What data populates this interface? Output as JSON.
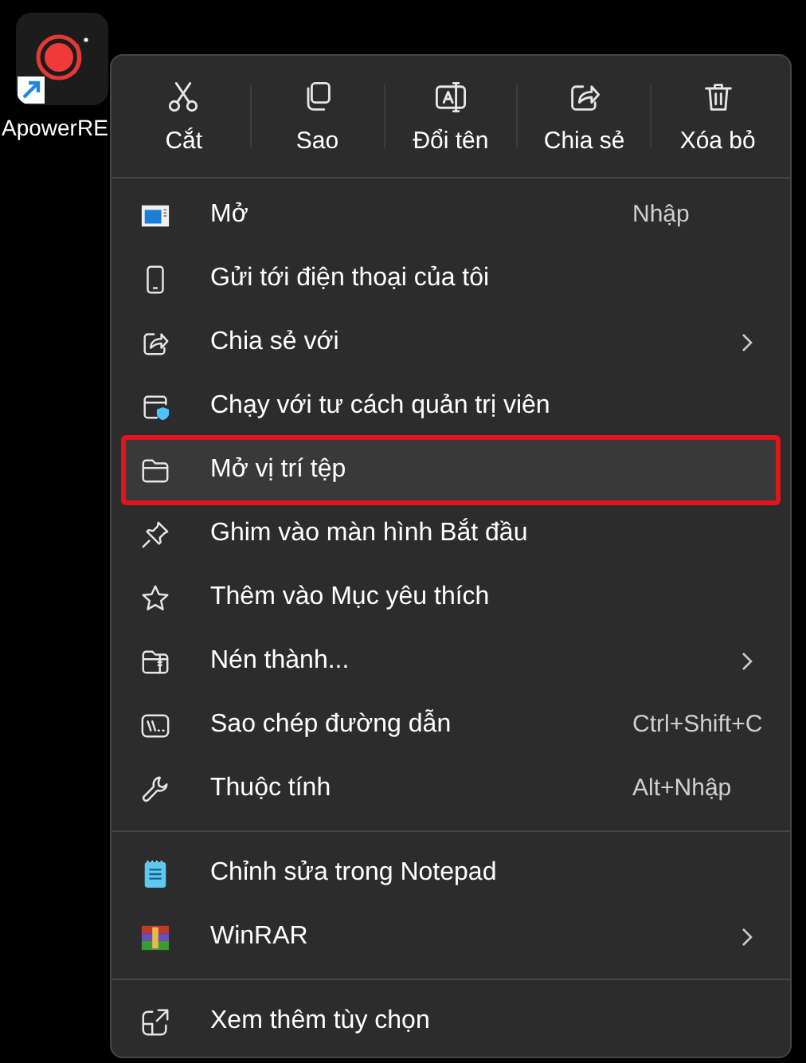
{
  "desktop_icon": {
    "label": "ApowerRE"
  },
  "toolbar": [
    {
      "kind": "cut",
      "label": "Cắt"
    },
    {
      "kind": "copy",
      "label": "Sao"
    },
    {
      "kind": "rename",
      "label": "Đổi tên"
    },
    {
      "kind": "share",
      "label": "Chia sẻ"
    },
    {
      "kind": "delete",
      "label": "Xóa bỏ"
    }
  ],
  "sections": [
    {
      "items": [
        {
          "kind": "open",
          "label": "Mở",
          "shortcut": "Nhập",
          "submenu": false,
          "selected": false
        },
        {
          "kind": "phone",
          "label": "Gửi tới điện thoại của tôi",
          "submenu": false,
          "selected": false
        },
        {
          "kind": "share",
          "label": "Chia sẻ với",
          "submenu": true,
          "selected": false
        },
        {
          "kind": "admin",
          "label": "Chạy với tư cách quản trị viên",
          "submenu": false,
          "selected": false
        },
        {
          "kind": "folder",
          "label": "Mở vị trí tệp",
          "submenu": false,
          "selected": true
        },
        {
          "kind": "pin",
          "label": "Ghim vào màn hình Bắt đầu",
          "submenu": false,
          "selected": false
        },
        {
          "kind": "star",
          "label": "Thêm vào Mục yêu thích",
          "submenu": false,
          "selected": false
        },
        {
          "kind": "zip",
          "label": "Nén thành...",
          "submenu": true,
          "selected": false
        },
        {
          "kind": "path",
          "label": "Sao chép đường dẫn",
          "shortcut": "Ctrl+Shift+C",
          "submenu": false,
          "selected": false
        },
        {
          "kind": "wrench",
          "label": "Thuộc tính",
          "shortcut": "Alt+Nhập",
          "submenu": false,
          "selected": false
        }
      ]
    },
    {
      "items": [
        {
          "kind": "notepad",
          "label": "Chỉnh sửa trong Notepad",
          "submenu": false,
          "selected": false
        },
        {
          "kind": "winrar",
          "label": "WinRAR",
          "submenu": true,
          "selected": false
        }
      ]
    },
    {
      "items": [
        {
          "kind": "more",
          "label": "Xem thêm tùy chọn",
          "submenu": false,
          "selected": false
        }
      ]
    }
  ]
}
